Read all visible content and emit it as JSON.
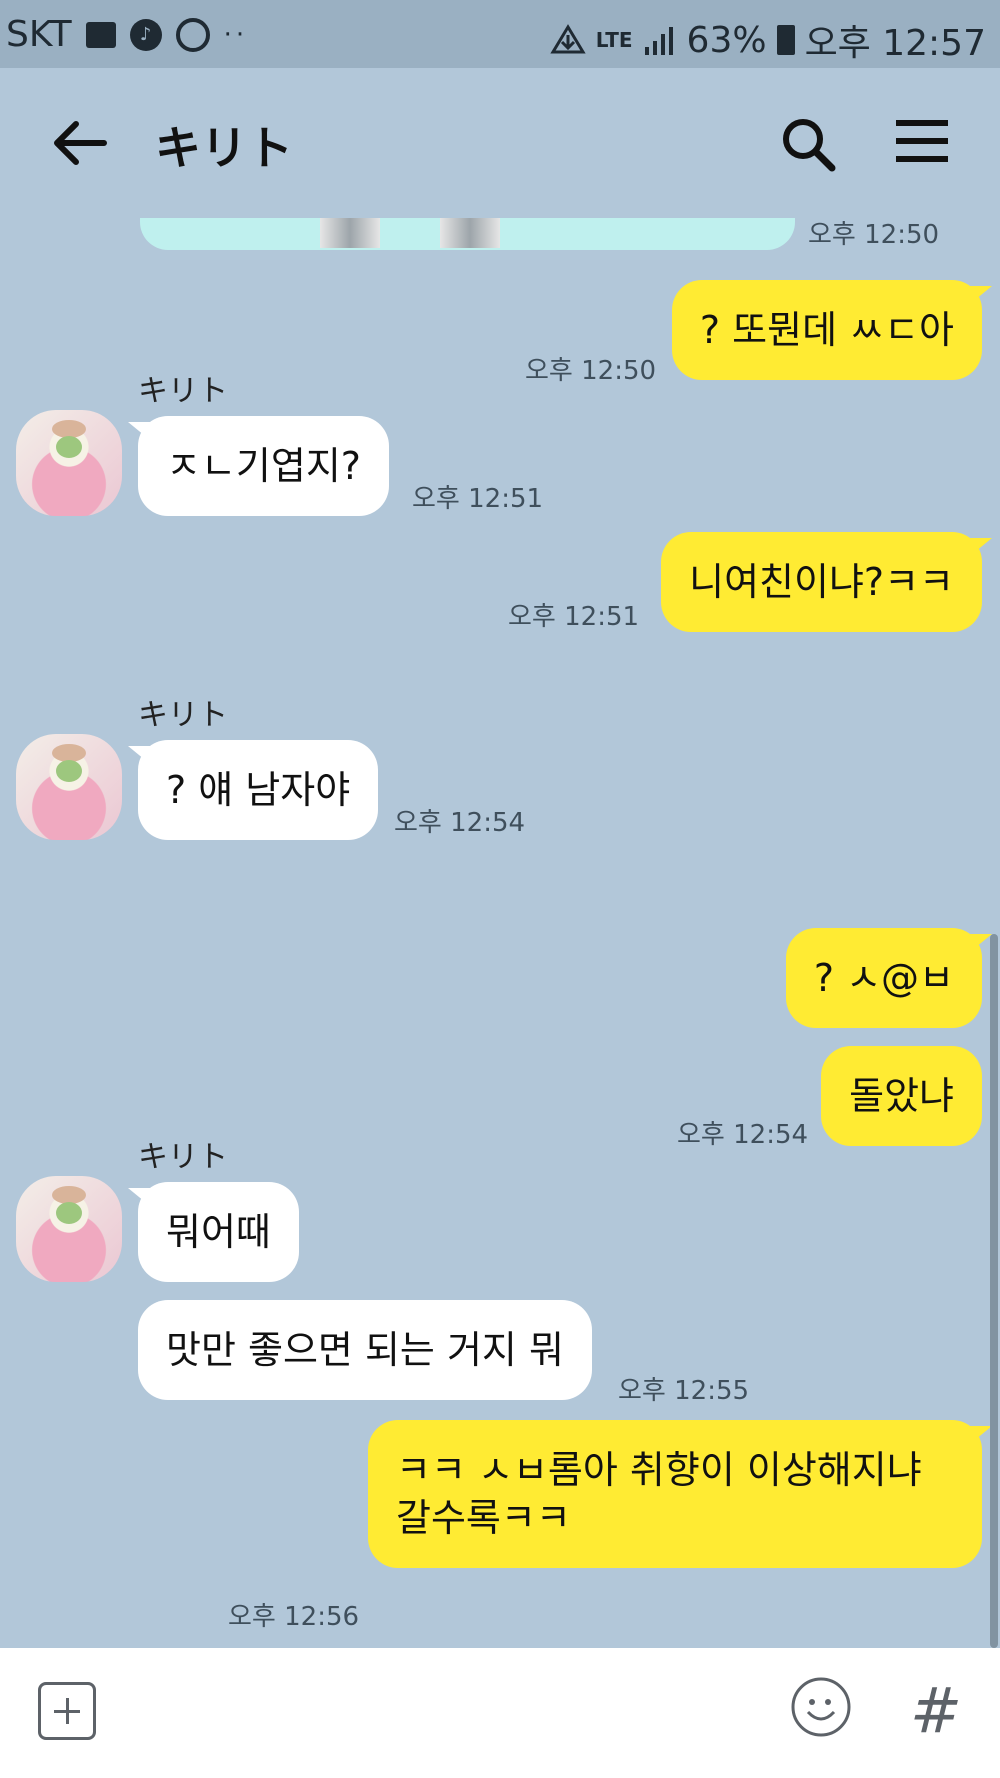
{
  "status_bar": {
    "carrier": "SKT",
    "network": "LTE",
    "battery": "63%",
    "time": "오후 12:57",
    "icons": [
      "gallery-icon",
      "music-icon",
      "sync-icon",
      "more-dots-icon",
      "data-saver-icon",
      "lte-icon",
      "signal-icon",
      "battery-icon"
    ]
  },
  "header": {
    "title": "キリト",
    "icons": [
      "back-arrow-icon",
      "search-icon",
      "menu-icon"
    ]
  },
  "chat": {
    "top_time": "오후 12:50",
    "messages": [
      {
        "from": "me",
        "text": "? 또뭔데 ㅆㄷ아",
        "time": "오후 12:50"
      },
      {
        "from": "other",
        "sender": "キリト",
        "text": "ㅈㄴ기엽지?",
        "time": "오후 12:51"
      },
      {
        "from": "me",
        "text": "니여친이냐?ㅋㅋ",
        "time": "오후 12:51"
      },
      {
        "from": "other",
        "sender": "キリト",
        "text": "? 얘 남자야",
        "time": "오후 12:54"
      },
      {
        "from": "me",
        "text": "? ㅅ@ㅂ",
        "time": ""
      },
      {
        "from": "me",
        "text": "돌았냐",
        "time": "오후 12:54"
      },
      {
        "from": "other",
        "sender": "キリト",
        "text": "뭐어때",
        "time": ""
      },
      {
        "from": "other",
        "text": "맛만 좋으면 되는 거지 뭐",
        "time": "오후 12:55"
      },
      {
        "from": "me",
        "text": "ㅋㅋ ㅅㅂ롬아 취향이 이상해지냐 갈수록ㅋㅋ",
        "time": "오후 12:56"
      }
    ]
  },
  "input_bar": {
    "hash_label": "#",
    "icons": [
      "plus-icon",
      "emoji-icon"
    ]
  },
  "colors": {
    "background": "#b2c7d9",
    "my_bubble": "#ffeb33",
    "other_bubble": "#ffffff",
    "status_bar": "#9ab0c2"
  }
}
